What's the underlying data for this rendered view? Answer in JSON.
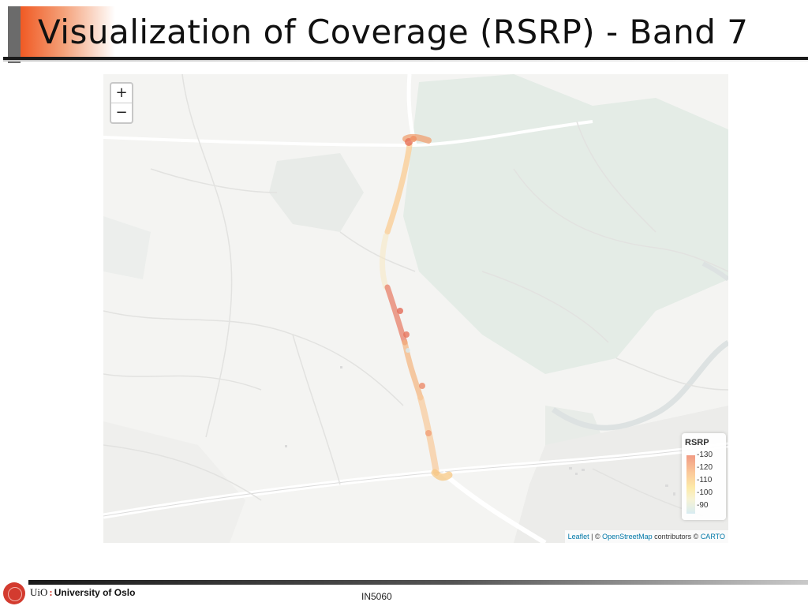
{
  "slide": {
    "title": "Visualization of Coverage (RSRP) - Band 7",
    "footer_course": "IN5060"
  },
  "branding": {
    "short": "UiO",
    "name": "University of Oslo"
  },
  "map": {
    "zoom_in_label": "+",
    "zoom_out_label": "−",
    "legend": {
      "title": "RSRP",
      "ticks": [
        "-130",
        "-120",
        "-110",
        "-100",
        "-90"
      ]
    },
    "attribution": {
      "leaflet": "Leaflet",
      "sep1": " | © ",
      "osm": "OpenStreetMap",
      "mid": " contributors © ",
      "carto": "CARTO"
    },
    "colors": {
      "low": "#f19b83",
      "mid": "#fdeaa8",
      "high": "#d8ecf2",
      "strong_path": "#e8806a"
    }
  }
}
